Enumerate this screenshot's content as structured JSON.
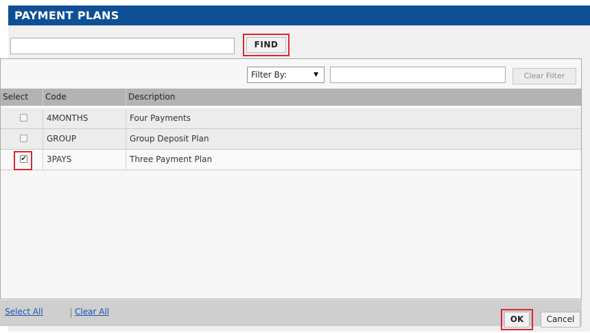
{
  "dialog": {
    "title": "PAYMENT PLANS",
    "find": {
      "input_value": "",
      "button_label": "FIND"
    },
    "filter": {
      "select_value": "Filter By:",
      "text_value": "",
      "clear_label": "Clear Filter"
    },
    "table": {
      "headers": [
        "Select",
        "Code",
        "Description"
      ],
      "rows": [
        {
          "checked": false,
          "code": "4MONTHS",
          "description": "Four Payments"
        },
        {
          "checked": false,
          "code": "GROUP",
          "description": "Group Deposit Plan"
        },
        {
          "checked": true,
          "code": "3PAYS",
          "description": "Three Payment Plan"
        }
      ]
    },
    "footer": {
      "select_all": "Select All",
      "clear_all": "Clear All",
      "ok": "OK",
      "cancel": "Cancel"
    }
  },
  "colors": {
    "titlebar": "#0e4f96",
    "highlight": "#d9262f",
    "link": "#1b54b5"
  },
  "icons": {
    "checkbox_checked": "checkbox-checked-icon",
    "dropdown": "dropdown-arrow-icon"
  }
}
